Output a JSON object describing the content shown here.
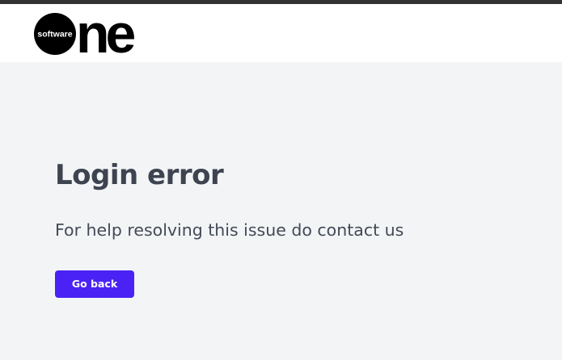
{
  "brand": {
    "logo_text_small": "software",
    "logo_text_large": "ne",
    "icon": "softwareone-logo"
  },
  "error": {
    "title": "Login error",
    "message": "For help resolving this issue do contact us"
  },
  "actions": {
    "go_back_label": "Go back"
  },
  "colors": {
    "top_strip": "#333333",
    "header_bg": "#ffffff",
    "page_bg": "#f3f4f6",
    "title_text": "#3d4450",
    "body_text": "#434a56",
    "button_bg": "#4a22f5",
    "button_text": "#ffffff"
  }
}
